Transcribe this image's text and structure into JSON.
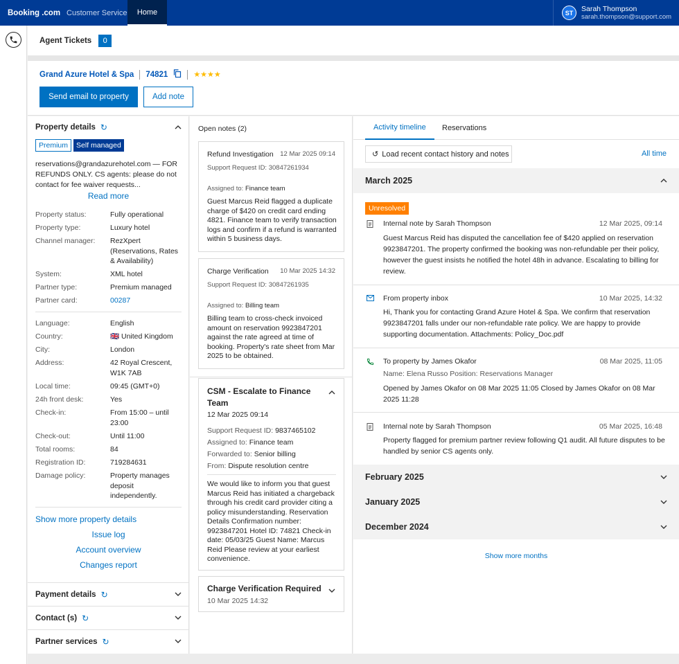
{
  "topbar": {
    "brand": "Booking",
    "brand_suffix": ".com",
    "product": "Customer Service",
    "nav_home": "Home",
    "user_initials": "ST",
    "user_name": "Sarah Thompson",
    "user_email": "sarah.thompson@support.com"
  },
  "tickets": {
    "label": "Agent Tickets",
    "count": "0"
  },
  "property": {
    "name": "Grand Azure Hotel & Spa",
    "id": "74821",
    "stars": "★★★★",
    "send_email_label": "Send email to property",
    "add_note_label": "Add note"
  },
  "details": {
    "title": "Property details",
    "tags": [
      "Premium",
      "Self managed"
    ],
    "email_note": "reservations@grandazurehotel.com — FOR REFUNDS ONLY. CS agents: please do not contact for fee waiver requests...",
    "read_more": "Read more",
    "rows1": [
      {
        "k": "Property status:",
        "v": "Fully operational"
      },
      {
        "k": "Property type:",
        "v": "Luxury hotel"
      },
      {
        "k": "Channel manager:",
        "v": "RezXpert (Reservations, Rates & Availability)"
      },
      {
        "k": "System:",
        "v": "XML hotel"
      },
      {
        "k": "Partner type:",
        "v": "Premium managed"
      },
      {
        "k": "Partner card:",
        "v": "00287"
      }
    ],
    "rows2": [
      {
        "k": "Language:",
        "v": "English"
      },
      {
        "k": "Country:",
        "v": "🇬🇧 United Kingdom"
      },
      {
        "k": "City:",
        "v": "London"
      },
      {
        "k": "Address:",
        "v": "42 Royal Crescent, W1K 7AB"
      },
      {
        "k": "Local time:",
        "v": "09:45 (GMT+0)"
      },
      {
        "k": "24h front desk:",
        "v": "Yes"
      },
      {
        "k": "Check-in:",
        "v": "From 15:00 – until 23:00"
      },
      {
        "k": "Check-out:",
        "v": "Until 11:00"
      },
      {
        "k": "Total rooms:",
        "v": "84"
      },
      {
        "k": "Registration ID:",
        "v": "719284631"
      },
      {
        "k": "Damage policy:",
        "v": "Property manages deposit independently."
      }
    ],
    "links": {
      "show_more": "Show more property details",
      "issue_log": "Issue log",
      "account_overview": "Account overview",
      "changes_report": "Changes report"
    },
    "payment": "Payment details",
    "contacts": "Contact (s)",
    "partner_services": "Partner services"
  },
  "notes": {
    "header": "Open notes (2)",
    "card1": {
      "title": "Refund Investigation",
      "date": "12 Mar 2025 09:14",
      "request": "Support Request ID: 30847261934",
      "assigned_label": "Assigned to:",
      "assigned": "Finance team",
      "body": "Guest Marcus Reid flagged a duplicate charge of $420 on credit card ending 4821. Finance team to verify transaction logs and confirm if a refund is warranted within 5 business days."
    },
    "card2": {
      "title": "Charge Verification",
      "date": "10 Mar 2025 14:32",
      "request": "Support Request ID: 30847261935",
      "assigned_label": "Assigned to:",
      "assigned": "Billing team",
      "body": "Billing team to cross-check invoiced amount on reservation 9923847201 against the rate agreed at time of booking. Property's rate sheet from Mar 2025 to be obtained."
    },
    "csm": {
      "title": "CSM - Escalate to Finance Team",
      "date": "12 Mar 2025 09:14",
      "request_label": "Support Request ID:",
      "request": "9837465102",
      "assigned_label": "Assigned to:",
      "assigned": "Finance team",
      "forwarded_label": "Forwarded to:",
      "forwarded": "Senior billing",
      "from_label": "From:",
      "from": "Dispute resolution centre",
      "body": "We would like to inform you that guest Marcus Reid has initiated a chargeback through his credit card provider citing a policy misunderstanding.  Reservation Details Confirmation number: 9923847201 Hotel ID: 74821 Check-in date: 05/03/25 Guest Name: Marcus Reid  Please review at your earliest convenience."
    },
    "collapsed": {
      "title": "Charge Verification Required",
      "date": "10 Mar 2025 14:32"
    }
  },
  "activity": {
    "tabs": [
      "Activity timeline",
      "Reservations"
    ],
    "load_label": "Load recent contact history and notes",
    "all_time": "All time",
    "months": [
      "March 2025",
      "February 2025",
      "January 2025",
      "December 2024"
    ],
    "unresolved": "Unresolved",
    "items": [
      {
        "icon": "note-icon",
        "title": "Internal note by Sarah Thompson",
        "date": "12 Mar 2025, 09:14",
        "body": "Guest Marcus Reid has disputed the cancellation fee of $420 applied on reservation 9923847201. The property confirmed the booking was non-refundable per their policy, however the guest insists he notified the hotel 48h in advance. Escalating to billing for review."
      },
      {
        "icon": "mail-icon",
        "title": "From property inbox",
        "date": "10 Mar 2025, 14:32",
        "body": "Hi,  Thank you for contacting Grand Azure Hotel & Spa. We confirm that reservation 9923847201 falls under our non-refundable rate policy. We are happy to provide supporting documentation.  Attachments: Policy_Doc.pdf"
      },
      {
        "icon": "phone-icon",
        "title": "To property by James Okafor",
        "date": "08 Mar 2025, 11:05",
        "sub": "Name: Elena Russo Position: Reservations Manager",
        "body": "Opened by James Okafor on 08 Mar 2025 11:05 Closed by James Okafor on 08 Mar 2025 11:28"
      },
      {
        "icon": "note-icon",
        "title": "Internal note by Sarah Thompson",
        "date": "05 Mar 2025, 16:48",
        "body": "Property flagged for premium partner review following Q1 audit. All future disputes to be handled by senior CS agents only."
      }
    ],
    "show_more": "Show more months"
  },
  "colors": {
    "brand": "#003b95",
    "accent": "#0071c2",
    "unresolved": "#ff8000",
    "stars": "#febb02"
  }
}
